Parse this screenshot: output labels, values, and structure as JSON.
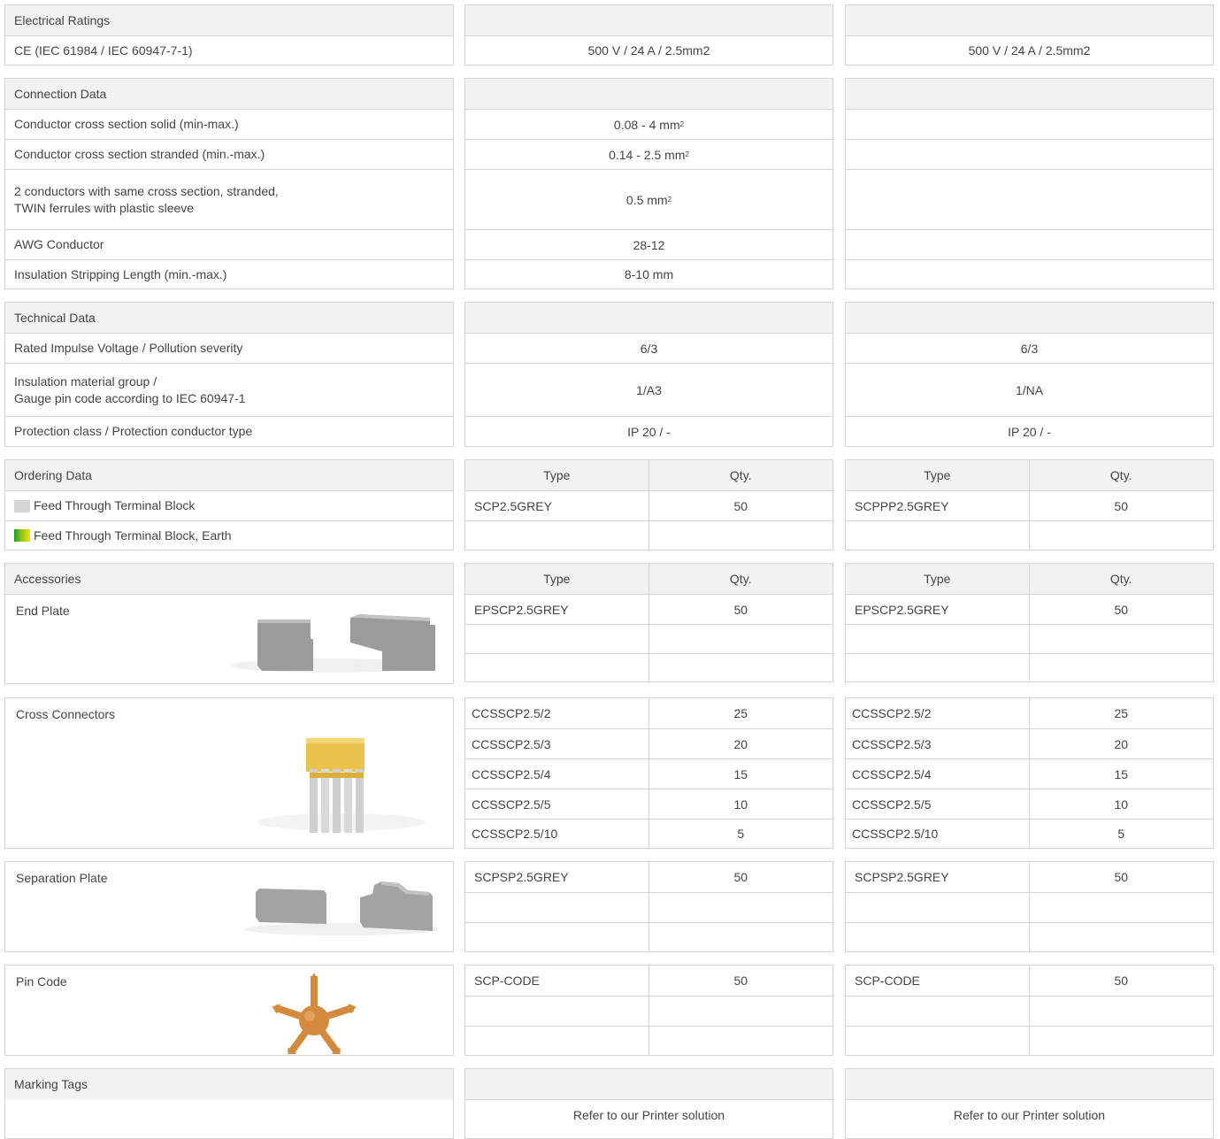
{
  "electrical": {
    "header": "Electrical Ratings",
    "row1_label": "CE (IEC 61984 / IEC 60947-7-1)",
    "row1_val_a": "500 V / 24 A / 2.5mm2",
    "row1_val_b": "500 V / 24 A / 2.5mm2"
  },
  "connection": {
    "header": "Connection Data",
    "solid_label": "Conductor cross section solid (min-max.)",
    "solid_val": "0.08 - 4 mm",
    "stranded_label": "Conductor cross section stranded (min.-max.)",
    "stranded_val": "0.14 - 2.5 mm",
    "twin_line1": "2 conductors with same cross section, stranded,",
    "twin_line2": "TWIN ferrules with plastic sleeve",
    "twin_val": "0.5 mm",
    "sup": "2",
    "awg_label": "AWG Conductor",
    "awg_val": "28-12",
    "strip_label": "Insulation Stripping Length (min.-max.)",
    "strip_val": "8-10 mm"
  },
  "technical": {
    "header": "Technical Data",
    "impulse_label": "Rated Impulse Voltage / Pollution severity",
    "impulse_a": "6/3",
    "impulse_b": "6/3",
    "insul_line1": "Insulation material group /",
    "insul_line2": "Gauge pin code according to IEC 60947-1",
    "insul_a": "1/A3",
    "insul_b": "1/NA",
    "protect_label": "Protection class / Protection conductor type",
    "protect_a": "IP 20 / -",
    "protect_b": "IP 20 / -"
  },
  "ordering": {
    "header": "Ordering Data",
    "type_hdr": "Type",
    "qty_hdr": "Qty.",
    "item1": "Feed Through Terminal Block",
    "item2": "Feed Through Terminal Block, Earth",
    "a_type": "SCP2.5GREY",
    "a_qty": "50",
    "b_type": "SCPPP2.5GREY",
    "b_qty": "50"
  },
  "accessories": {
    "header": "Accessories",
    "type_hdr": "Type",
    "qty_hdr": "Qty.",
    "end_plate": {
      "label": "End Plate",
      "a_type": "EPSCP2.5GREY",
      "a_qty": "50",
      "b_type": "EPSCP2.5GREY",
      "b_qty": "50"
    },
    "cross": {
      "label": "Cross Connectors",
      "rows": [
        {
          "type": "CCSSCP2.5/2",
          "qty": "25"
        },
        {
          "type": "CCSSCP2.5/3",
          "qty": "20"
        },
        {
          "type": "CCSSCP2.5/4",
          "qty": "15"
        },
        {
          "type": "CCSSCP2.5/5",
          "qty": "10"
        },
        {
          "type": "CCSSCP2.5/10",
          "qty": "5"
        }
      ]
    },
    "separation": {
      "label": "Separation Plate",
      "a_type": "SCPSP2.5GREY",
      "a_qty": "50",
      "b_type": "SCPSP2.5GREY",
      "b_qty": "50"
    },
    "pin": {
      "label": "Pin Code",
      "a_type": "SCP-CODE",
      "a_qty": "50",
      "b_type": "SCP-CODE",
      "b_qty": "50"
    }
  },
  "marking": {
    "header": "Marking Tags",
    "a_val": "Refer to our Printer solution",
    "b_val": "Refer to our Printer solution"
  },
  "colors": {
    "border": "#d4d4d4",
    "header_bg": "#f2f2f2",
    "text": "#444444",
    "connector_yellow": "#e8c24a",
    "pin_orange": "#d38a3c"
  }
}
